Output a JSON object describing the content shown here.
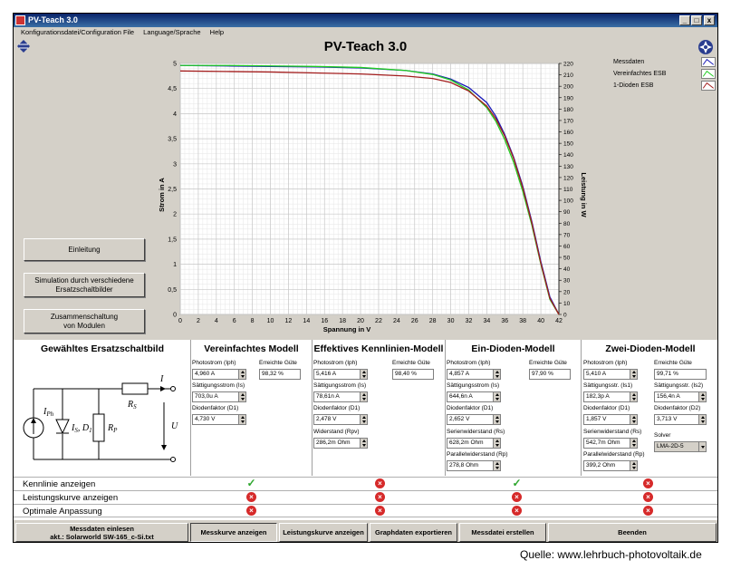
{
  "window": {
    "title": "PV-Teach 3.0",
    "minimize": "_",
    "maximize": "□",
    "close": "x"
  },
  "menu": [
    "Konfigurationsdatei/Configuration File",
    "Language/Sprache",
    "Help"
  ],
  "app_title": "PV-Teach 3.0",
  "left_buttons": {
    "einleitung": "Einleitung",
    "simulation": "Simulation durch verschiedene Ersatzschaltbilder",
    "zusammen": "Zusammenschaltung von Modulen"
  },
  "legend": [
    {
      "name": "Messdaten",
      "color": "#1a1ab8"
    },
    {
      "name": "Vereinfachtes ESB",
      "color": "#22cc22"
    },
    {
      "name": "1-Dioden ESB",
      "color": "#a31d1d"
    }
  ],
  "chart_data": {
    "type": "line",
    "xlabel": "Spannung in V",
    "ylabel": "Strom in A",
    "y2label": "Leistung in W",
    "xlim": [
      0,
      42
    ],
    "ylim": [
      0,
      5
    ],
    "y2lim": [
      0,
      220
    ],
    "xticks": [
      0,
      2,
      4,
      6,
      8,
      10,
      12,
      14,
      16,
      18,
      20,
      22,
      24,
      26,
      28,
      30,
      32,
      34,
      36,
      38,
      40,
      42
    ],
    "yticks": [
      0,
      0.5,
      1,
      1.5,
      2,
      2.5,
      3,
      3.5,
      4,
      4.5,
      5
    ],
    "ytick_labels": [
      "0",
      "0,5",
      "1",
      "1,5",
      "2",
      "2,5",
      "3",
      "3,5",
      "4",
      "4,5",
      "5"
    ],
    "y2ticks": [
      0,
      10,
      20,
      30,
      40,
      50,
      60,
      70,
      80,
      90,
      100,
      110,
      120,
      130,
      140,
      150,
      160,
      170,
      180,
      190,
      200,
      210,
      220
    ],
    "grid": true,
    "series": [
      {
        "name": "Messdaten",
        "color": "#1a1ab8",
        "x": [
          0,
          5,
          10,
          15,
          20,
          25,
          28,
          30,
          32,
          34,
          35,
          36,
          37,
          38,
          39,
          40,
          41,
          42
        ],
        "y": [
          4.96,
          4.95,
          4.94,
          4.93,
          4.91,
          4.86,
          4.79,
          4.69,
          4.52,
          4.22,
          3.95,
          3.58,
          3.12,
          2.55,
          1.85,
          1.05,
          0.35,
          0.0
        ]
      },
      {
        "name": "Vereinfachtes ESB",
        "color": "#22cc22",
        "x": [
          0,
          5,
          10,
          15,
          20,
          25,
          28,
          30,
          32,
          34,
          35,
          36,
          37,
          38,
          39,
          40,
          41,
          42
        ],
        "y": [
          4.96,
          4.96,
          4.95,
          4.94,
          4.92,
          4.86,
          4.78,
          4.67,
          4.47,
          4.12,
          3.85,
          3.48,
          3.02,
          2.45,
          1.78,
          1.0,
          0.3,
          0.0
        ]
      },
      {
        "name": "1-Dioden ESB",
        "color": "#a31d1d",
        "x": [
          0,
          5,
          10,
          15,
          20,
          25,
          28,
          30,
          32,
          34,
          35,
          36,
          37,
          38,
          39,
          40,
          41,
          42
        ],
        "y": [
          4.85,
          4.84,
          4.83,
          4.81,
          4.79,
          4.75,
          4.7,
          4.62,
          4.45,
          4.15,
          3.9,
          3.55,
          3.1,
          2.52,
          1.82,
          1.02,
          0.32,
          0.0
        ]
      }
    ]
  },
  "circuit": {
    "title": "Gewähltes Ersatzschaltbild",
    "labels": {
      "iph": "I",
      "iph_sub": "Ph",
      "is": "I",
      "is_sub": "S",
      "d1": ", D",
      "d1_sub": "1",
      "rp": "R",
      "rp_sub": "P",
      "rs": "R",
      "rs_sub": "S",
      "i": "I",
      "u": "U"
    }
  },
  "models": {
    "vereinfacht": {
      "title": "Vereinfachtes Modell",
      "params": [
        {
          "label": "Photostrom (Iph)",
          "value": "4,960 A"
        },
        {
          "label": "Sättigungsstrom (Is)",
          "value": "703,0u A"
        },
        {
          "label": "Diodenfaktor (D1)",
          "value": "4,730 V"
        }
      ],
      "guete_label": "Erreichte Güte",
      "guete": "98,32 %"
    },
    "effektiv": {
      "title": "Effektives Kennlinien-Modell",
      "params": [
        {
          "label": "Photostrom (Iph)",
          "value": "5,416 A"
        },
        {
          "label": "Sättigungsstrom (Is)",
          "value": "78,61n A"
        },
        {
          "label": "Diodenfaktor (D1)",
          "value": "2,478 V"
        },
        {
          "label": "Widerstand (Rpv)",
          "value": "286,2m Ohm"
        }
      ],
      "guete_label": "Erreichte Güte",
      "guete": "98,40 %"
    },
    "eindioden": {
      "title": "Ein-Dioden-Modell",
      "params": [
        {
          "label": "Photostrom (Iph)",
          "value": "4,857 A"
        },
        {
          "label": "Sättigungsstrom (Is)",
          "value": "644,6n A"
        },
        {
          "label": "Diodenfaktor (D1)",
          "value": "2,652 V"
        },
        {
          "label": "Serienwiderstand (Rs)",
          "value": "628,2m Ohm"
        },
        {
          "label": "Parallelwiderstand (Rp)",
          "value": "278,8 Ohm"
        }
      ],
      "guete_label": "Erreichte Güte",
      "guete": "97,90 %"
    },
    "zweidioden": {
      "title": "Zwei-Dioden-Modell",
      "params": [
        {
          "label": "Photostrom (Iph)",
          "value": "5,410 A"
        },
        {
          "label": "Sättigungsstr. (Is1)",
          "value": "182,3p A"
        },
        {
          "label": "Diodenfaktor (D1)",
          "value": "1,857 V"
        },
        {
          "label": "Serienwiderstand (Rs)",
          "value": "542,7m Ohm"
        },
        {
          "label": "Parallelwiderstand (Rp)",
          "value": "399,2 Ohm"
        }
      ],
      "right_params": [
        {
          "label": "Erreichte Güte",
          "value": "99,71 %"
        },
        {
          "label": "Sättigungsstr. (Is2)",
          "value": "156,4n A"
        },
        {
          "label": "Diodenfaktor (D2)",
          "value": "3,713 V"
        }
      ],
      "solver_label": "Solver",
      "solver": "LMA-2D-5"
    }
  },
  "options": [
    {
      "label": "Kennlinie anzeigen",
      "states": [
        "check",
        "cross",
        "check",
        "cross"
      ]
    },
    {
      "label": "Leistungskurve anzeigen",
      "states": [
        "cross",
        "cross",
        "cross",
        "cross"
      ]
    },
    {
      "label": "Optimale Anpassung",
      "states": [
        "cross",
        "cross",
        "cross",
        "cross"
      ]
    }
  ],
  "bottom": {
    "messdaten_line1": "Messdaten einlesen",
    "messdaten_line2": "akt.: Solarworld SW-165_c-Si.txt",
    "messkurve": "Messkurve anzeigen",
    "leistungskurve": "Leistungskurve anzeigen",
    "graphdaten": "Graphdaten exportieren",
    "messdatei": "Messdatei erstellen",
    "beenden": "Beenden"
  },
  "quelle": "Quelle: www.lehrbuch-photovoltaik.de"
}
